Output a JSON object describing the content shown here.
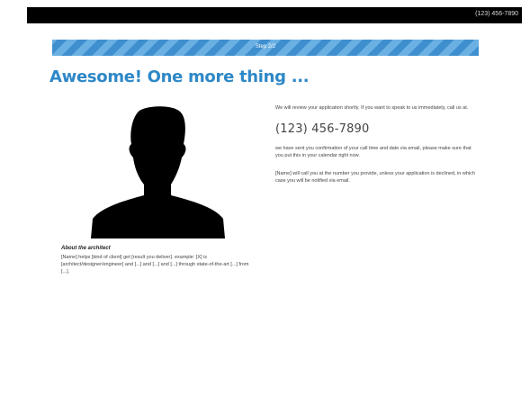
{
  "header": {
    "phone": "(123) 456-7890"
  },
  "progress": {
    "label": "Step 2/2",
    "value": 1.0
  },
  "page": {
    "headline": "Awesome! One more thing ..."
  },
  "profile": {
    "title": "About the architect",
    "text": "[Name] helps [kind of client] get [result you deliver]. example: [X] is [architect/designer/engineer] and [...] and [...] and [...] through state-of-the-art [...] from [...]."
  },
  "info": {
    "para1": "We will review your application shortly. If you want to speak to us immediately, call us at.",
    "phone": "(123) 456-7890",
    "para2": "we have sent you confirmation of your call time and date via email, please make sure that you put this in your calendar right now.",
    "para3": "[Name] will call you at the number you provide, unless your application is declined, in which case you will be notified via email."
  },
  "icons": {
    "avatar": "person-silhouette-icon"
  }
}
